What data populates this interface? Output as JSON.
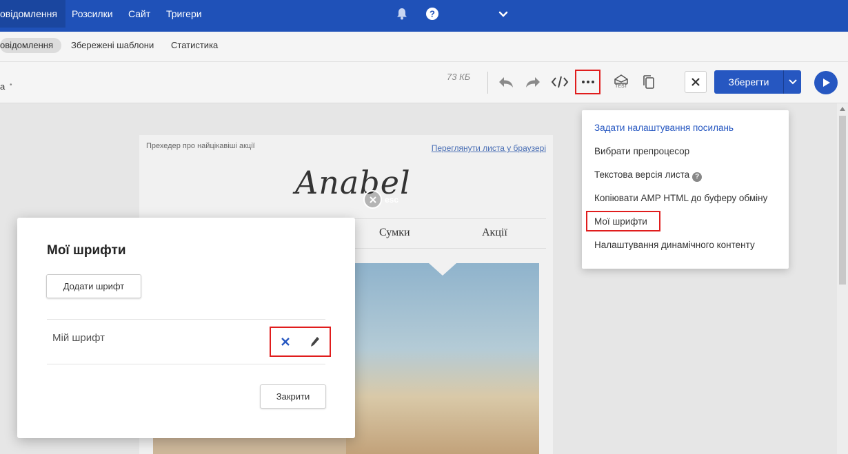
{
  "topnav": {
    "items": [
      {
        "label": "овідомлення",
        "active": true
      },
      {
        "label": "Розсилки"
      },
      {
        "label": "Сайт"
      },
      {
        "label": "Тригери"
      }
    ]
  },
  "subnav": {
    "items": [
      {
        "label": "овідомлення",
        "active": true
      },
      {
        "label": "Збережені шаблони"
      },
      {
        "label": "Статистика"
      }
    ]
  },
  "toolbar": {
    "left_fragment": "а",
    "left_dot": "•",
    "size": "73 КБ",
    "test_label": "TEST",
    "save_label": "Зберегти"
  },
  "email": {
    "preheader": "Прехедер про найцікавіші акції",
    "view_link": "Переглянути листа у браузері",
    "logo": "Anabel",
    "menu": [
      "Сумки",
      "Акції"
    ]
  },
  "overlay": {
    "esc_label": "esc"
  },
  "modal": {
    "title": "Мої шрифти",
    "add_button": "Додати шрифт",
    "font_name": "Мій шрифт",
    "close_button": "Закрити"
  },
  "dropdown": {
    "items": [
      "Задати налаштування посилань",
      "Вибрати препроцесор",
      "Текстова версія листа",
      "Копіювати AMP HTML до буферу обміну",
      "Мої шрифти",
      "Налаштування динамічного контенту"
    ],
    "help_glyph": "?"
  },
  "colors": {
    "primary": "#2657c1",
    "topbar": "#1f51b8",
    "highlight": "#e01d1d"
  }
}
